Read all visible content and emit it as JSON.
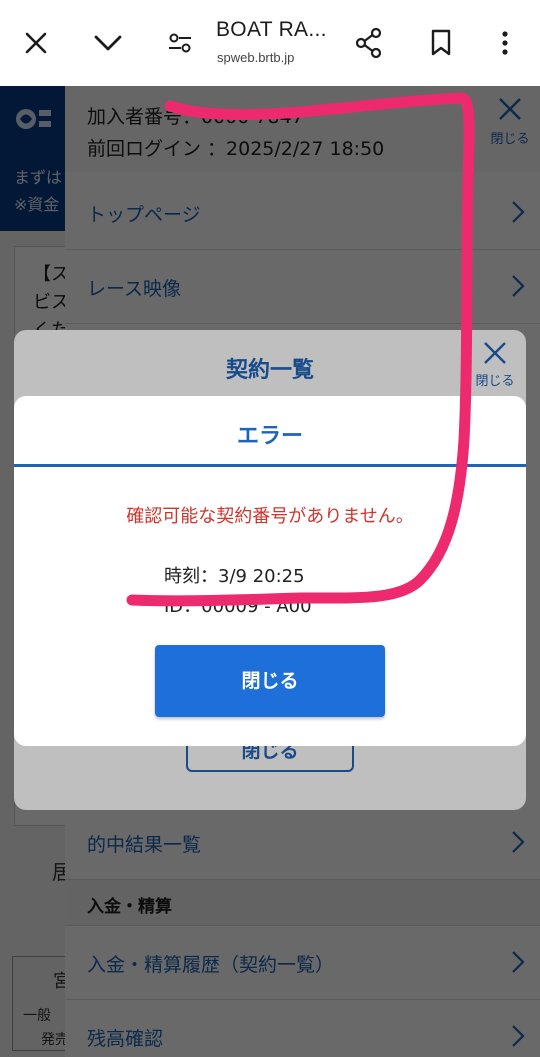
{
  "browser": {
    "title": "BOAT RA...",
    "url": "spweb.brtb.jp"
  },
  "background": {
    "header_line1": "まずは",
    "header_line2": "※資金",
    "card_line1": "【ス",
    "card_line2": "ビス",
    "card_line3": "くた",
    "item_text": "居",
    "button_line1": "宮",
    "button_line2": "一般",
    "button_line3": "発売"
  },
  "menu": {
    "member_number": "加入者番号：0000 7847",
    "last_login": "前回ログイン ：2025/2/27 18:50",
    "close_label": "閉じる",
    "items": [
      {
        "label": "トップページ"
      },
      {
        "label": "レース映像"
      },
      {
        "label": "的中結果一覧"
      }
    ],
    "section_label": "入金・精算",
    "section_items": [
      {
        "label": "入金・精算履歴（契約一覧）"
      },
      {
        "label": "残高確認"
      }
    ]
  },
  "contract_dialog": {
    "title": "契約一覧",
    "close_label": "閉じる",
    "close_button": "閉じる"
  },
  "error_dialog": {
    "title": "エラー",
    "message": "確認可能な契約番号がありません。",
    "time": "時刻：3/9 20:25",
    "id": "ID：00009 - A00",
    "close_button": "閉じる"
  },
  "colors": {
    "accent": "#1f64b8",
    "error": "#d0352c",
    "button": "#1e6fd9",
    "scribble": "#ee2a6e"
  },
  "icons": [
    "close-icon",
    "chevron-down-icon",
    "tune-icon",
    "share-icon",
    "bookmark-icon",
    "more-vert-icon",
    "chevron-right-icon"
  ]
}
